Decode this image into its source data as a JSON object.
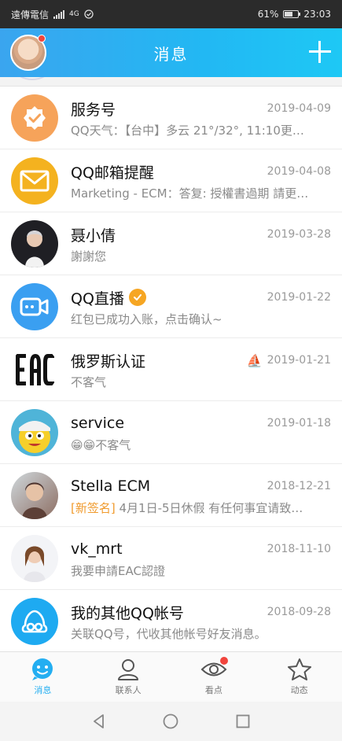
{
  "status_bar": {
    "carrier": "遠傳電信",
    "network": "4G",
    "battery": "61%",
    "time": "23:03"
  },
  "header": {
    "title": "消息",
    "add_icon": "plus-icon"
  },
  "conversations": [
    {
      "name": "服务号",
      "date": "2019-04-09",
      "preview": "QQ天气：【台中】多云 21°/32°, 11:10更…",
      "icon": "badge-check-icon"
    },
    {
      "name": "QQ邮箱提醒",
      "date": "2019-04-08",
      "preview": "Marketing - ECM：答复: 授權書過期 請更…",
      "icon": "mail-icon"
    },
    {
      "name": "聂小倩",
      "date": "2019-03-28",
      "preview": "謝謝您",
      "icon": "user-avatar"
    },
    {
      "name": "QQ直播",
      "date": "2019-01-22",
      "preview": "红包已成功入账，点击确认~",
      "icon": "video-camera-icon",
      "verified": true
    },
    {
      "name": "俄罗斯认证",
      "date": "2019-01-21",
      "preview": "不客气",
      "icon": "eac-logo",
      "status_icon": "⛵"
    },
    {
      "name": "service",
      "date": "2019-01-18",
      "preview": "😁😁不客气",
      "icon": "cartoon-avatar"
    },
    {
      "name": "Stella ECM",
      "date": "2018-12-21",
      "preview_tag": "[新签名]",
      "preview": "4月1日-5日休假 有任何事宜请致…",
      "icon": "user-avatar"
    },
    {
      "name": "vk_mrt",
      "date": "2018-11-10",
      "preview": "我要申請EAC認證",
      "icon": "user-avatar"
    },
    {
      "name": "我的其他QQ帐号",
      "date": "2018-09-28",
      "preview": "关联QQ号，代收其他帐号好友消息。",
      "icon": "linked-accounts-icon"
    }
  ],
  "tabs": [
    {
      "label": "消息",
      "active": true
    },
    {
      "label": "联系人",
      "active": false
    },
    {
      "label": "看点",
      "active": false,
      "has_dot": true
    },
    {
      "label": "动态",
      "active": false
    }
  ],
  "colors": {
    "accent": "#23aef1",
    "orange": "#f6a623",
    "badge_red": "#f1453d"
  }
}
